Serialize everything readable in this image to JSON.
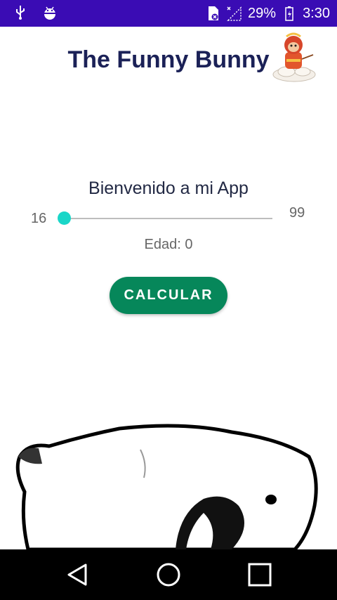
{
  "status_bar": {
    "battery_percent": "29%",
    "time": "3:30",
    "icons": [
      "usb-icon",
      "android-debug-icon",
      "sim-card-icon",
      "signal-icon",
      "battery-icon"
    ]
  },
  "app": {
    "title": "The Funny Bunny",
    "accent_color": "#06875a",
    "status_bar_color": "#3a0cb4",
    "title_color": "#1b2157"
  },
  "main": {
    "welcome": "Bienvenido a mi App",
    "slider": {
      "min_label": "16",
      "max_label": "99",
      "value": 0,
      "thumb_color": "#1ad6c8"
    },
    "age_text": "Edad: 0",
    "calculate_button": "CALCULAR"
  },
  "nav_bar": {
    "icons": [
      "back-icon",
      "home-icon",
      "recents-icon"
    ]
  }
}
